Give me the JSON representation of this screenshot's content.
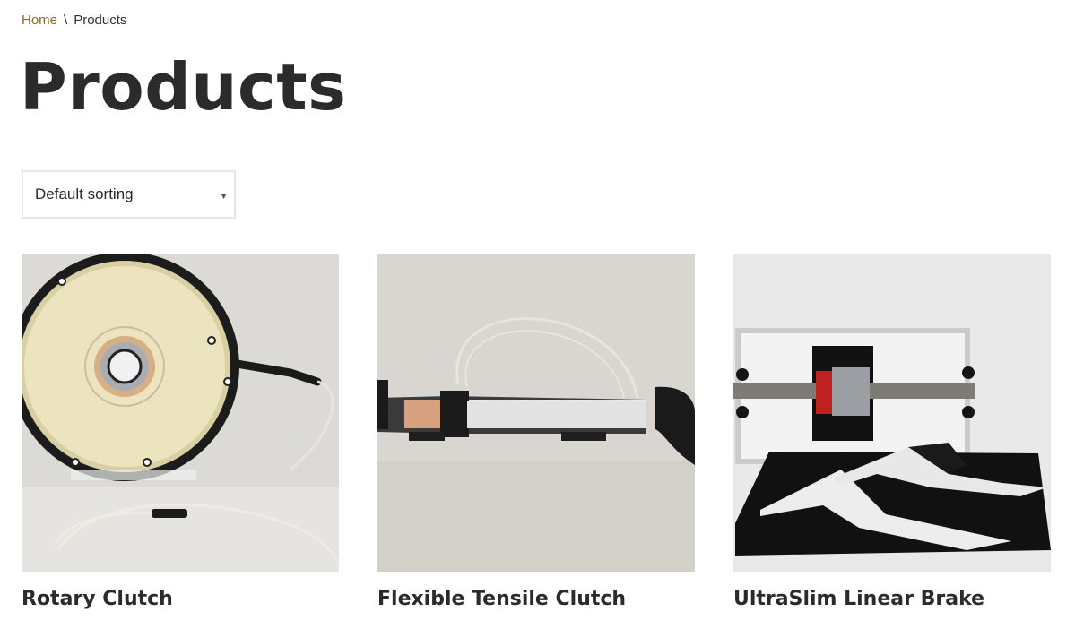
{
  "breadcrumb": {
    "home_label": "Home",
    "separator": "\\",
    "current_label": "Products"
  },
  "page": {
    "title": "Products"
  },
  "sorting": {
    "selected": "Default sorting"
  },
  "products": [
    {
      "name": "Rotary Clutch",
      "image_icon": "rotary-clutch-photo"
    },
    {
      "name": "Flexible Tensile Clutch",
      "image_icon": "flexible-tensile-clutch-photo"
    },
    {
      "name": "UltraSlim Linear Brake",
      "image_icon": "ultraslim-linear-brake-photo"
    }
  ],
  "colors": {
    "link": "#8a6a2e",
    "text": "#2b2b2b",
    "border": "#e6e6e6"
  }
}
